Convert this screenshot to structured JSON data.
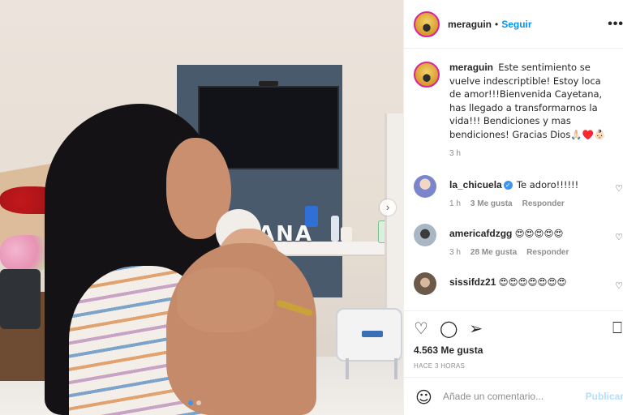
{
  "post": {
    "username": "meraguin",
    "follow_label": "Seguir",
    "separator": "•",
    "more_label": "•••",
    "caption": "Este sentimiento se vuelve indescriptible! Estoy loca de amor!!!Bienvenida Cayetana, has llegado a transformarnos la vida!!! Bendiciones y mas bendiciones! Gracias Dios🙏🏻♥️👶🏻",
    "caption_time": "3 h",
    "photo_letters": "ANA",
    "carousel_next": "›"
  },
  "comments": [
    {
      "username": "la_chicuela",
      "verified": true,
      "text": "Te adoro!!!!!!",
      "time": "1 h",
      "likes": "3 Me gusta",
      "reply": "Responder",
      "avatar_color": "#7a86c9"
    },
    {
      "username": "americafdzgg",
      "verified": false,
      "text": "😍😍😍😍😍",
      "time": "3 h",
      "likes": "28 Me gusta",
      "reply": "Responder",
      "avatar_color": "#8fa0b3"
    },
    {
      "username": "sissifdz21",
      "verified": false,
      "text": "😍😍😍😍😍😍😍",
      "avatar_color": "#6b5a4a"
    }
  ],
  "actions": {
    "like_icon": "♡",
    "comment_icon": "◯",
    "share_icon": "➢",
    "bookmark_icon": "⎕",
    "likes_count": "4.563 Me gusta",
    "posted_ago": "HACE 3 HORAS"
  },
  "composer": {
    "emoji_icon": "☺",
    "placeholder": "Añade un comentario...",
    "publish_label": "Publicar"
  },
  "colors": {
    "accent": "#0095f6",
    "verified": "#3897f0"
  }
}
